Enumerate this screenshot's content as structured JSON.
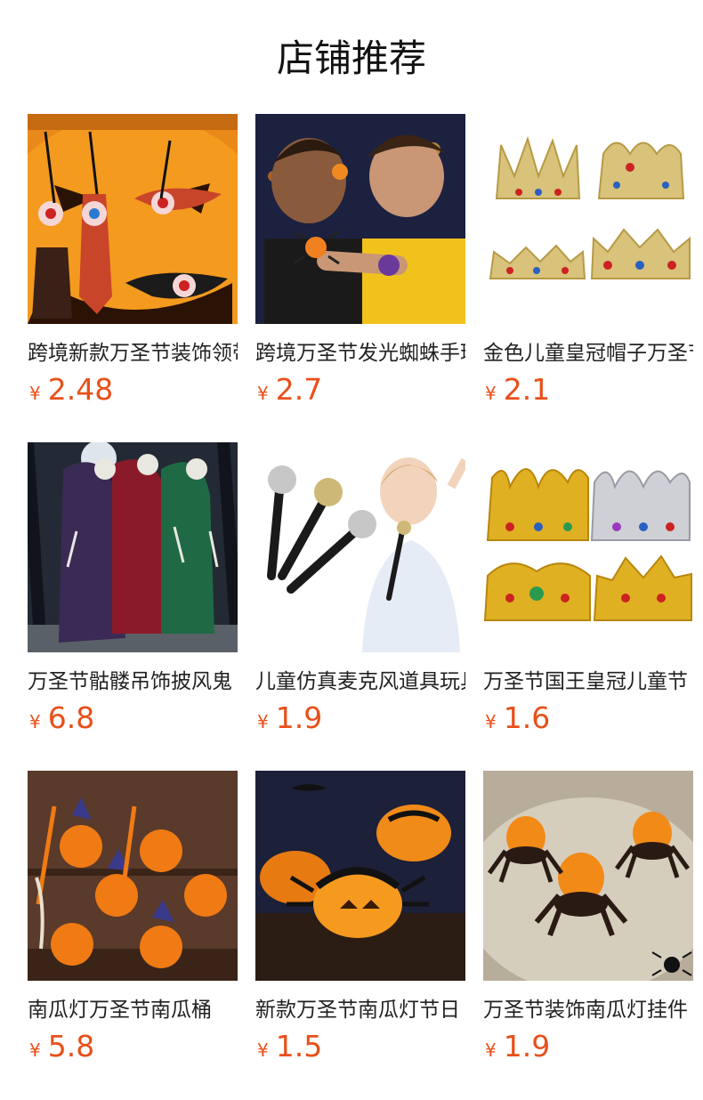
{
  "header": {
    "title": "店铺推荐"
  },
  "currency_symbol": "¥",
  "products": [
    {
      "name": "跨境新款万圣节装饰领带",
      "price": "2.48",
      "image": "pumpkin-ties-image"
    },
    {
      "name": "跨境万圣节发光蜘蛛手环",
      "price": "2.7",
      "image": "kids-spider-bracelet-image"
    },
    {
      "name": "金色儿童皇冠帽子万圣节",
      "price": "2.1",
      "image": "gold-crowns-image"
    },
    {
      "name": "万圣节骷髅吊饰披风鬼",
      "price": "6.8",
      "image": "hanging-skeleton-ghosts-image"
    },
    {
      "name": "儿童仿真麦克风道具玩具",
      "price": "1.9",
      "image": "toy-microphone-image"
    },
    {
      "name": "万圣节国王皇冠儿童节",
      "price": "1.6",
      "image": "king-crowns-image"
    },
    {
      "name": "南瓜灯万圣节南瓜桶",
      "price": "5.8",
      "image": "pumpkin-lantern-buckets-image"
    },
    {
      "name": "新款万圣节南瓜灯节日",
      "price": "1.5",
      "image": "spider-pumpkin-lamp-image"
    },
    {
      "name": "万圣节装饰南瓜灯挂件",
      "price": "1.9",
      "image": "spider-candle-lights-image"
    }
  ],
  "colors": {
    "price": "#e8501a",
    "title": "#111111",
    "name": "#222222"
  }
}
